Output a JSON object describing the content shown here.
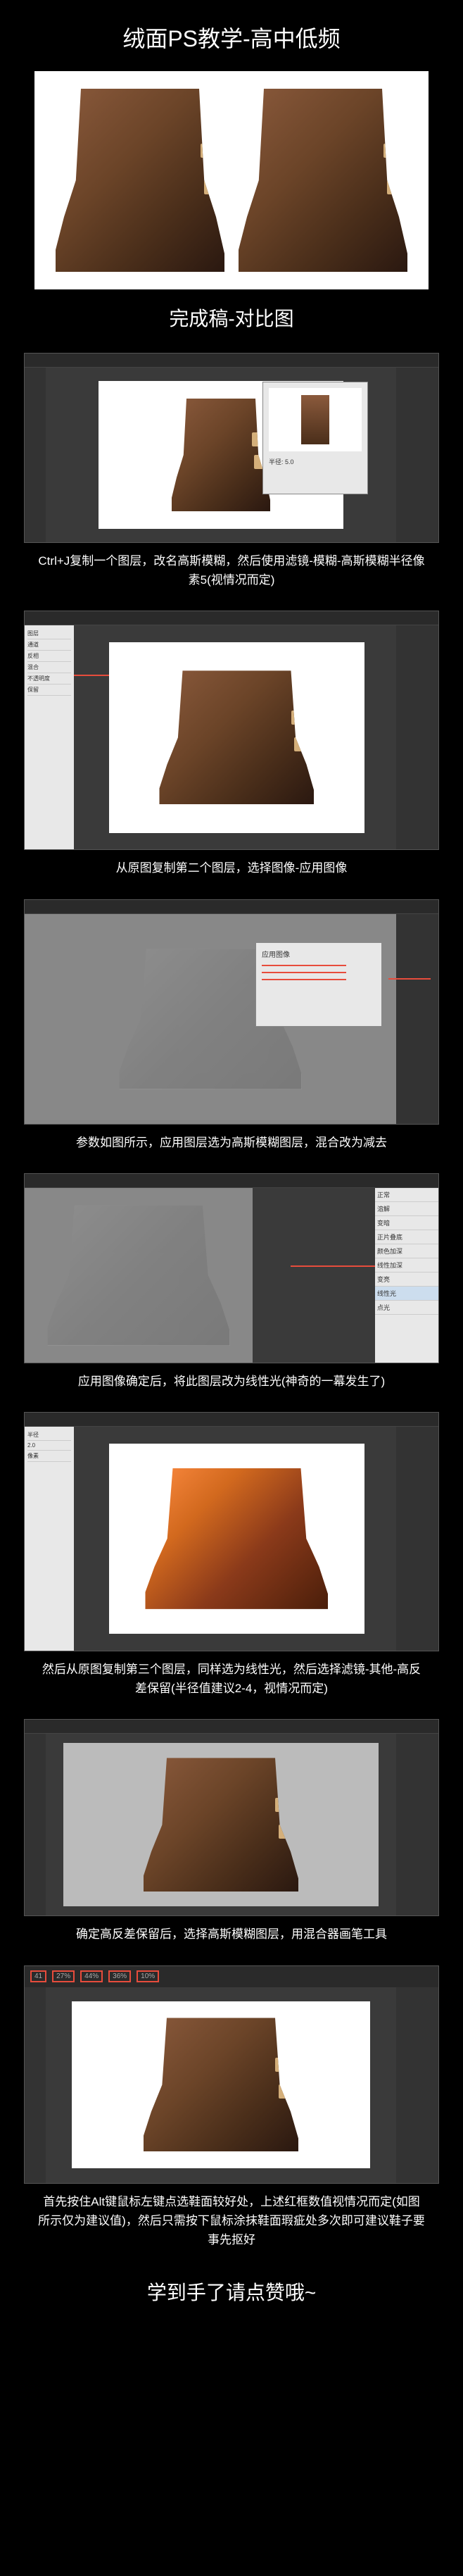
{
  "title": "绒面PS教学-高中低频",
  "subtitle": "完成稿-对比图",
  "ending": "学到手了请点赞哦~",
  "steps": [
    {
      "caption": "Ctrl+J复制一个图层，改名高斯模糊，然后使用滤镜-模糊-高斯模糊半径像素5(视情况而定)"
    },
    {
      "caption": "从原图复制第二个图层，选择图像-应用图像"
    },
    {
      "caption": "参数如图所示，应用图层选为高斯模糊图层，混合改为减去"
    },
    {
      "caption": "应用图像确定后，将此图层改为线性光(神奇的一幕发生了)"
    },
    {
      "caption": "然后从原图复制第三个图层，同样选为线性光，然后选择滤镜-其他-高反差保留(半径值建议2-4，视情况而定)"
    },
    {
      "caption": "确定高反差保留后，选择高斯模糊图层，用混合器画笔工具"
    },
    {
      "caption": "首先按住Alt键鼠标左键点选鞋面较好处，上述红框数值视情况而定(如图所示仅为建议值)，然后只需按下鼠标涂抹鞋面瑕疵处多次即可建议鞋子要事先抠好"
    }
  ],
  "toolbar_values": {
    "v1": "41",
    "v2": "27%",
    "v3": "44%",
    "v4": "36%",
    "v5": "10%"
  }
}
